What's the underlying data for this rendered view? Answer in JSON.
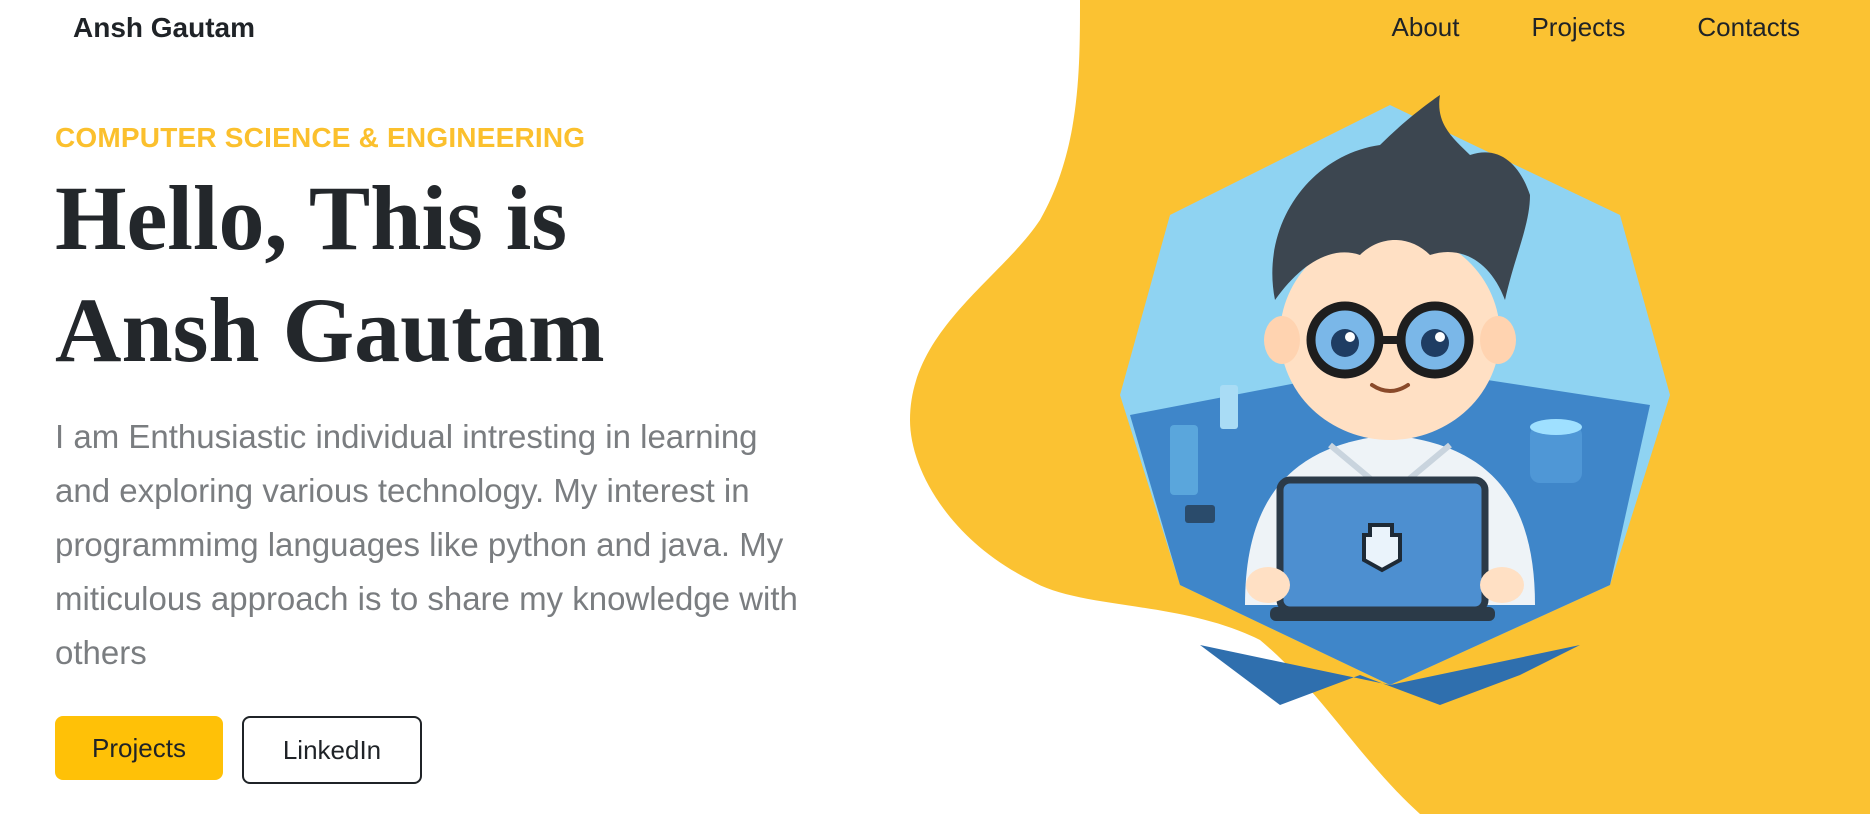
{
  "header": {
    "brand": "Ansh Gautam",
    "nav": [
      "About",
      "Projects",
      "Contacts"
    ]
  },
  "hero": {
    "eyebrow": "COMPUTER SCIENCE & ENGINEERING",
    "headline_line1": "Hello, This is",
    "headline_line2": "Ansh Gautam",
    "bio": "I am Enthusiastic individual intresting in learning and exploring various technology. My interest in programmimg languages like python and java. My miticulous approach is to share my knowledge with others",
    "primary_button": "Projects",
    "secondary_button": "LinkedIn"
  },
  "colors": {
    "accent": "#fbc02d",
    "button_yellow": "#ffc107",
    "heading": "#23272b",
    "body_text": "#7a7d80"
  },
  "illustration": {
    "icon": "avatar-illustration"
  }
}
